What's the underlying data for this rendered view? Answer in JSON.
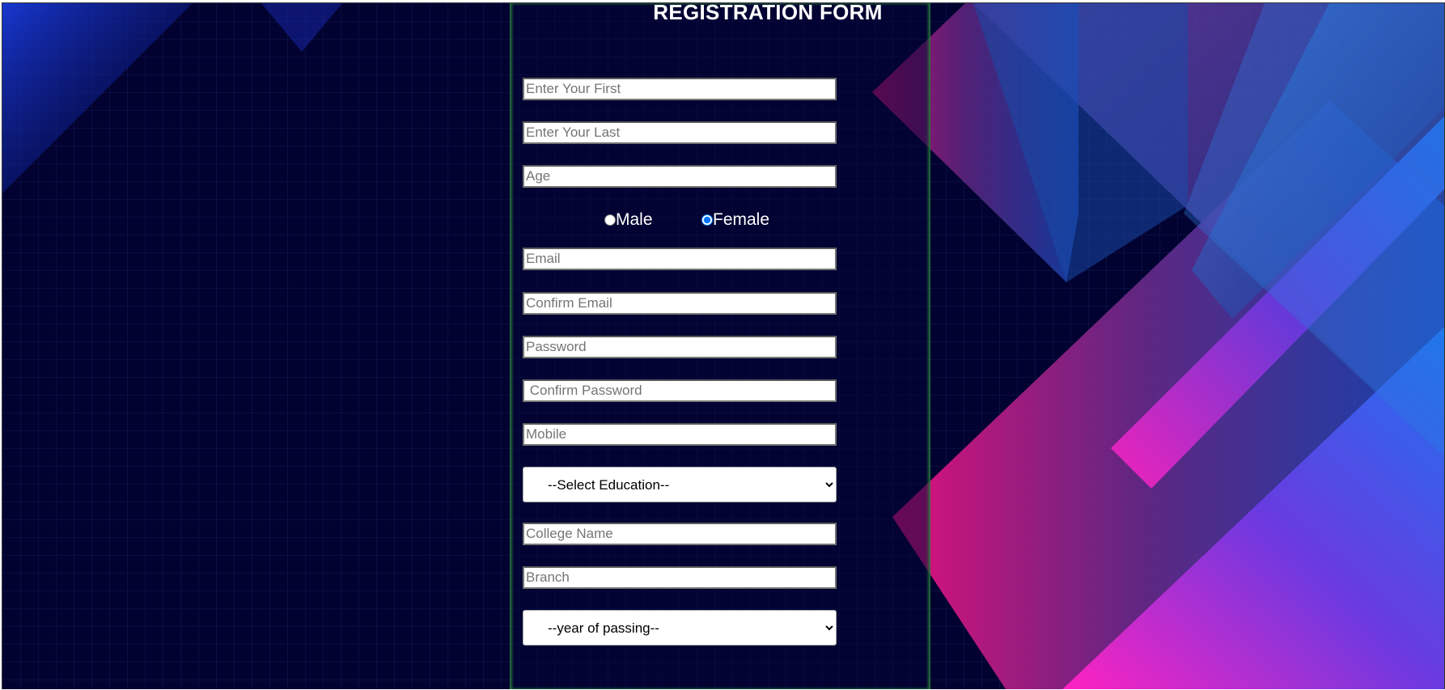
{
  "form": {
    "title": "REGISTRATION FORM",
    "fields": {
      "first_name": {
        "placeholder": "Enter Your First",
        "value": ""
      },
      "last_name": {
        "placeholder": "Enter Your Last",
        "value": ""
      },
      "age": {
        "placeholder": "Age",
        "value": ""
      },
      "email": {
        "placeholder": "Email",
        "value": ""
      },
      "confirm_email": {
        "placeholder": "Confirm Email",
        "value": ""
      },
      "password": {
        "placeholder": "Password",
        "value": ""
      },
      "confirm_password": {
        "placeholder": " Confirm Password",
        "value": ""
      },
      "mobile": {
        "placeholder": "Mobile",
        "value": ""
      },
      "college": {
        "placeholder": "College Name",
        "value": ""
      },
      "branch": {
        "placeholder": "Branch",
        "value": ""
      }
    },
    "gender": {
      "male_label": "Male",
      "female_label": "Female",
      "selected": "Female"
    },
    "education": {
      "selected": "--Select Education--"
    },
    "year_of_passing": {
      "selected": "--year of passing--"
    }
  },
  "colors": {
    "background": "#020230",
    "panel_border": "#2f8f3a",
    "accent_pink": "#e0158a",
    "accent_blue": "#1b6fe0"
  }
}
